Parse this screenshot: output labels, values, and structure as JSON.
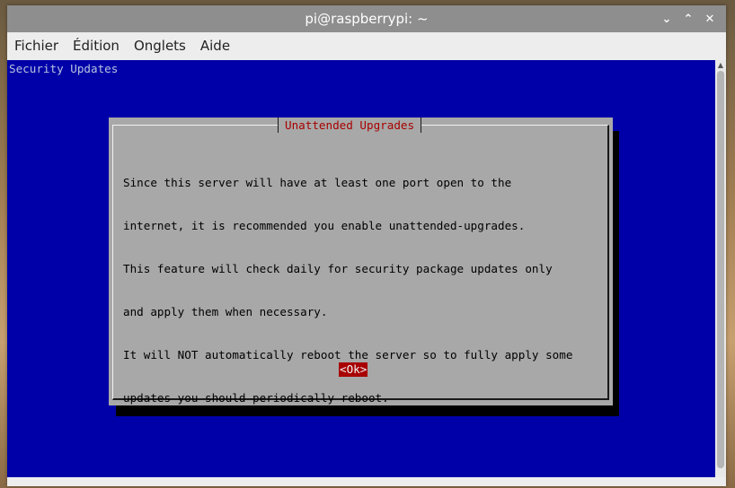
{
  "window": {
    "title": "pi@raspberrypi: ~",
    "controls": {
      "minimize": "⌄",
      "maximize": "⌃",
      "close": "✕"
    }
  },
  "menubar": {
    "items": [
      "Fichier",
      "Édition",
      "Onglets",
      "Aide"
    ]
  },
  "terminal": {
    "backtitle": "Security Updates",
    "dialog": {
      "title": "Unattended Upgrades",
      "lines": [
        "Since this server will have at least one port open to the",
        "internet, it is recommended you enable unattended-upgrades.",
        "This feature will check daily for security package updates only",
        "and apply them when necessary.",
        "It will NOT automatically reboot the server so to fully apply some",
        "updates you should periodically reboot."
      ],
      "ok_label": "<Ok>"
    }
  },
  "colors": {
    "terminal_bg": "#0000a8",
    "dialog_bg": "#a8a8a8",
    "accent_red": "#a80000",
    "titlebar": "#8e8e8e"
  },
  "icons": {
    "minimize": "chevron-down-icon",
    "maximize": "chevron-up-icon",
    "close": "close-icon"
  }
}
